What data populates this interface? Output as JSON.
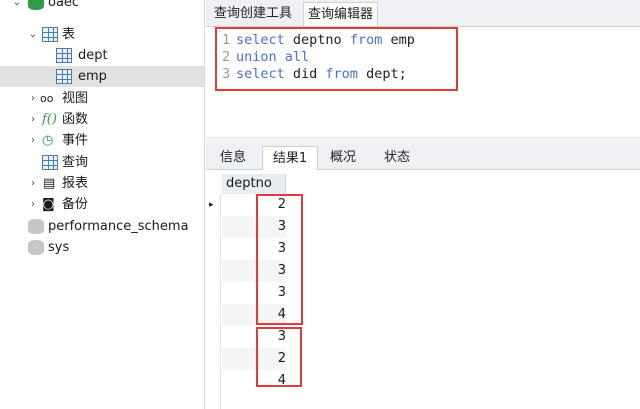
{
  "sidebar": {
    "items": [
      {
        "label": "oaec",
        "icon": "database-icon",
        "expanded": true
      },
      {
        "label": "表",
        "icon": "table-folder-icon",
        "expanded": true
      },
      {
        "label": "dept",
        "icon": "table-icon"
      },
      {
        "label": "emp",
        "icon": "table-icon",
        "selected": true
      },
      {
        "label": "视图",
        "icon": "view-icon"
      },
      {
        "label": "函数",
        "icon": "function-icon"
      },
      {
        "label": "事件",
        "icon": "event-icon"
      },
      {
        "label": "查询",
        "icon": "query-icon"
      },
      {
        "label": "报表",
        "icon": "report-icon"
      },
      {
        "label": "备份",
        "icon": "backup-icon"
      },
      {
        "label": "performance_schema",
        "icon": "database-icon"
      },
      {
        "label": "sys",
        "icon": "database-icon"
      }
    ]
  },
  "editor_tabs": [
    {
      "label": "查询创建工具"
    },
    {
      "label": "查询编辑器",
      "active": true
    }
  ],
  "editor": {
    "lines": [
      {
        "num": "1",
        "kw1": "select",
        "t1": " deptno ",
        "kw2": "from",
        "t2": " emp"
      },
      {
        "num": "2",
        "kw1": "union all",
        "t1": "",
        "kw2": "",
        "t2": ""
      },
      {
        "num": "3",
        "kw1": "select",
        "t1": " did ",
        "kw2": "from",
        "t2": " dept;"
      }
    ]
  },
  "result_tabs": [
    {
      "label": "信息"
    },
    {
      "label": "结果1",
      "active": true
    },
    {
      "label": "概况"
    },
    {
      "label": "状态"
    }
  ],
  "result": {
    "column": "deptno",
    "rows": [
      "2",
      "3",
      "3",
      "3",
      "3",
      "4",
      "3",
      "2",
      "4"
    ]
  },
  "colors": {
    "keyword": "#4b6ed6",
    "highlight_box": "#e23b3b",
    "db_green": "#2e9c4a"
  }
}
